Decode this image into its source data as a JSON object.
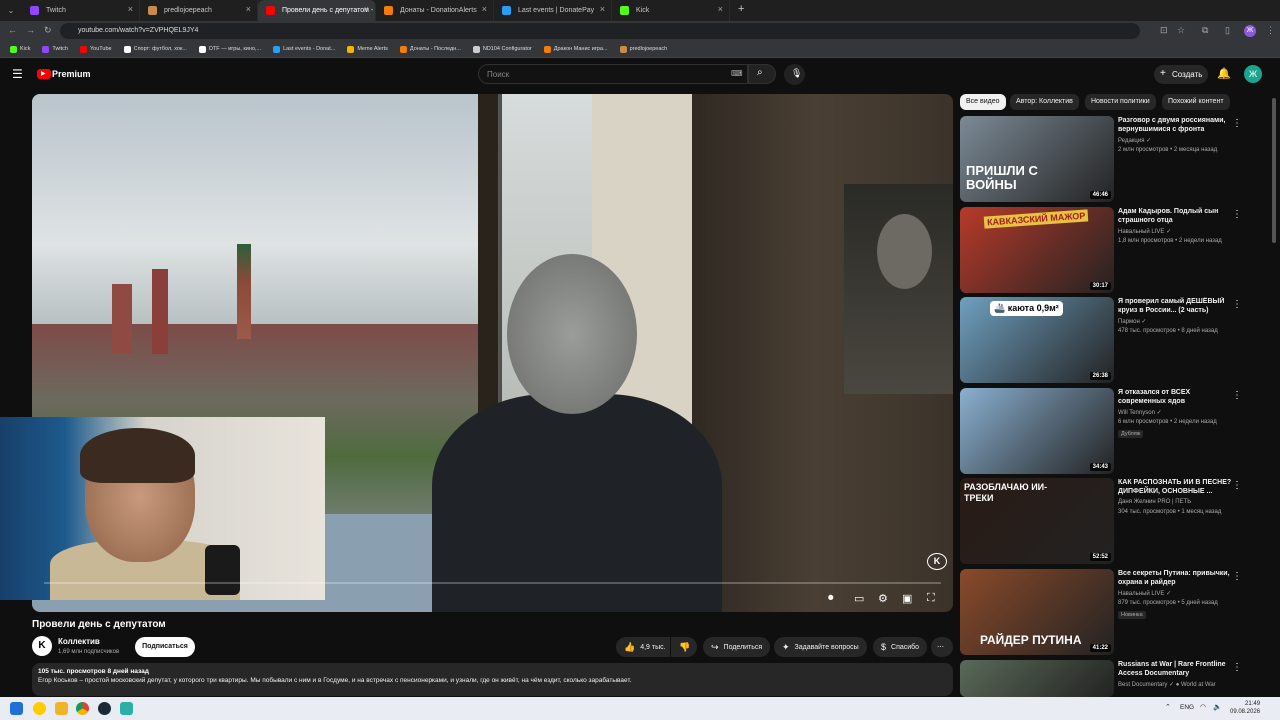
{
  "browser": {
    "tabs": [
      {
        "label": "Twitch",
        "color": "#9146ff"
      },
      {
        "label": "predlojoepeach",
        "color": "#c98a4a"
      },
      {
        "label": "Провели день с депутатом - Y",
        "color": "#ff0000",
        "active": true
      },
      {
        "label": "Донаты - DonationAlerts",
        "color": "#f57d07"
      },
      {
        "label": "Last events | DonatePay",
        "color": "#2a9df4"
      },
      {
        "label": "Kick",
        "color": "#53fc18"
      }
    ],
    "url": "youtube.com/watch?v=ZVPHQEL9JY4",
    "bookmarks": [
      {
        "label": "Kick",
        "color": "#53fc18"
      },
      {
        "label": "Twitch",
        "color": "#9146ff"
      },
      {
        "label": "YouTube",
        "color": "#ff0000"
      },
      {
        "label": "Спорт: футбол, хок...",
        "color": "#ffffff"
      },
      {
        "label": "DTF — игры, кино,...",
        "color": "#ffffff"
      },
      {
        "label": "Last events - Donat...",
        "color": "#2a9df4"
      },
      {
        "label": "Meme Alerts",
        "color": "#f5b400"
      },
      {
        "label": "Донаты - Последн...",
        "color": "#f57d07"
      },
      {
        "label": "ND104 Configurator",
        "color": "#cccccc"
      },
      {
        "label": "Дракон Манис игра...",
        "color": "#f57d07"
      },
      {
        "label": "predlojoepeach",
        "color": "#c98a4a"
      }
    ]
  },
  "header": {
    "logo_label": "Premium",
    "search_placeholder": "Поиск",
    "create_label": "Создать",
    "avatar_letter": "Ж"
  },
  "player": {
    "watermark": "K"
  },
  "video": {
    "title": "Провели день с депутатом",
    "channel": "Коллектив",
    "channel_avatar": "K",
    "subscribers": "1,69 млн подписчиков",
    "subscribe_label": "Подписаться",
    "likes": "4,9 тыс.",
    "share_label": "Поделиться",
    "ask_label": "Задавайте вопросы",
    "thanks_label": "Спасибо",
    "views_date": "105 тыс. просмотров  8 дней назад",
    "description": "Егор Коськов – простой московский депутат, у которого три квартиры. Мы побывали с ним и в Госдуме, и на встречах с пенсионерками, и узнали, где он живёт, на чём ездит, сколько зарабатывает."
  },
  "chips": [
    "Все видео",
    "Автор: Коллектив",
    "Новости политики",
    "Похожий контент"
  ],
  "recommendations": [
    {
      "title": "Разговор с двумя россиянами, вернувшимися с фронта",
      "channel": "Редакция ✓",
      "meta": "2 млн просмотров • 2 месяца назад",
      "duration": "46:46",
      "thumb_text": "ПРИШЛИ С ВОЙНЫ",
      "bg": "#7c8a96"
    },
    {
      "title": "Адам Кадыров. Подлый сын страшного отца",
      "channel": "Навальный LIVE ✓",
      "meta": "1,8 млн просмотров • 2 недели назад",
      "duration": "30:17",
      "thumb_text": "КАВКАЗСКИЙ МАЖОР",
      "bg": "#b83a2a"
    },
    {
      "title": "Я проверил самый ДЕШЁВЫЙ круиз в России... (2 часть)",
      "channel": "Пармон ✓",
      "meta": "478 тыс. просмотров • 8 дней назад",
      "duration": "26:38",
      "thumb_text": "🚢 каюта 0,9м²",
      "bg": "#6fa0c0"
    },
    {
      "title": "Я отказался от ВСЕХ современных ядов",
      "channel": "Will Tennyson ✓",
      "meta": "6 млн просмотров • 2 недели назад",
      "duration": "34:43",
      "badge": "Дубляж",
      "thumb_text": "",
      "bg": "#8ab0d0"
    },
    {
      "title": "КАК РАСПОЗНАТЬ ИИ В ПЕСНЕ? ДИПФЕЙКИ, ОСНОВНЫЕ ...",
      "channel": "Даня Желнин PRO | ПЕТЬ",
      "meta": "304 тыс. просмотров • 1 месяц назад",
      "duration": "52:52",
      "thumb_text": "РАЗОБЛАЧАЮ ИИ-ТРЕКИ",
      "bg": "#2a1a14"
    },
    {
      "title": "Все секреты Путина: привычки, охрана и райдер",
      "channel": "Навальный LIVE ✓",
      "meta": "879 тыс. просмотров • 5 дней назад",
      "duration": "41:22",
      "badge": "Новинка",
      "thumb_text": "РАЙДЕР ПУТИНА",
      "bg": "#8a4a2a"
    },
    {
      "title": "Russians at War | Rare Frontline Access Documentary",
      "channel": "Best Documentary ✓ ● World at War",
      "meta": "",
      "duration": "",
      "thumb_text": "",
      "bg": "#5a6a58"
    }
  ],
  "taskbar": {
    "lang": "ENG",
    "time": "21:49",
    "date": "09.08.2026"
  }
}
